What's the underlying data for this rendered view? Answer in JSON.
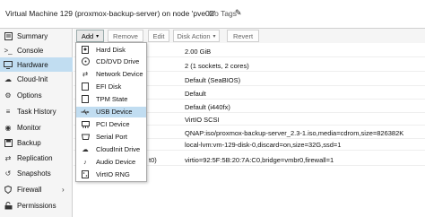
{
  "header": {
    "title": "Virtual Machine 129 (proxmox-backup-server) on node 'pve02'",
    "tags": "No Tags"
  },
  "toolbar": {
    "add": "Add",
    "remove": "Remove",
    "edit": "Edit",
    "disk_action": "Disk Action",
    "revert": "Revert"
  },
  "nav": [
    {
      "label": "Summary",
      "icon": "summary-icon"
    },
    {
      "label": "Console",
      "icon": "console-icon"
    },
    {
      "label": "Hardware",
      "icon": "monitor-icon",
      "selected": true
    },
    {
      "label": "Cloud-Init",
      "icon": "cloud-icon"
    },
    {
      "label": "Options",
      "icon": "gear-icon"
    },
    {
      "label": "Task History",
      "icon": "list-icon"
    },
    {
      "label": "Monitor",
      "icon": "eye-icon"
    },
    {
      "label": "Backup",
      "icon": "floppy-icon"
    },
    {
      "label": "Replication",
      "icon": "retweet-icon"
    },
    {
      "label": "Snapshots",
      "icon": "history-icon"
    },
    {
      "label": "Firewall",
      "icon": "shield-icon"
    },
    {
      "label": "Permissions",
      "icon": "unlock-icon"
    }
  ],
  "rows": [
    {
      "key": "",
      "value": "2.00 GiB"
    },
    {
      "key": "",
      "value": "2 (1 sockets, 2 cores)"
    },
    {
      "key": "",
      "value": "Default (SeaBIOS)"
    },
    {
      "key": "",
      "value": "Default"
    },
    {
      "key": "",
      "value": "Default (i440fx)"
    },
    {
      "key": "",
      "value": "VirtIO SCSI"
    },
    {
      "key": "",
      "value": "QNAP:iso/proxmox-backup-server_2.3-1.iso,media=cdrom,size=826382K"
    },
    {
      "key": "",
      "value": "local-lvm:vm-129-disk-0,discard=on,size=32G,ssd=1"
    },
    {
      "key": "t0)",
      "value": "virtio=92:5F:5B:20:7A:C0,bridge=vmbr0,firewall=1"
    }
  ],
  "menu": [
    {
      "label": "Hard Disk",
      "icon": "hdd-icon"
    },
    {
      "label": "CD/DVD Drive",
      "icon": "cdrom-icon"
    },
    {
      "label": "Network Device",
      "icon": "network-icon"
    },
    {
      "label": "EFI Disk",
      "icon": "efi-disk-icon"
    },
    {
      "label": "TPM State",
      "icon": "tpm-icon"
    },
    {
      "label": "USB Device",
      "icon": "usb-icon",
      "highlighted": true
    },
    {
      "label": "PCI Device",
      "icon": "pci-icon"
    },
    {
      "label": "Serial Port",
      "icon": "serial-icon"
    },
    {
      "label": "CloudInit Drive",
      "icon": "cloud-icon"
    },
    {
      "label": "Audio Device",
      "icon": "audio-icon"
    },
    {
      "label": "VirtIO RNG",
      "icon": "rng-icon"
    }
  ]
}
